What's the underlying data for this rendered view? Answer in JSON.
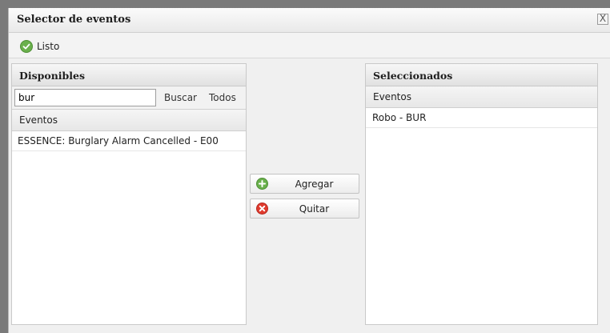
{
  "dialog": {
    "title": "Selector de eventos",
    "close_label": "X"
  },
  "toolbar": {
    "done_label": "Listo"
  },
  "available": {
    "title": "Disponibles",
    "search_value": "bur",
    "search_button": "Buscar",
    "all_button": "Todos",
    "column_header": "Eventos",
    "rows": [
      "ESSENCE: Burglary Alarm Cancelled - E00"
    ]
  },
  "actions": {
    "add_label": "Agregar",
    "remove_label": "Quitar"
  },
  "selected": {
    "title": "Seleccionados",
    "column_header": "Eventos",
    "rows": [
      "Robo - BUR"
    ]
  },
  "colors": {
    "accent_green": "#6ab04c",
    "remove_red": "#e03b2e"
  },
  "icons": {
    "done": "check-circle-icon",
    "add": "plus-circle-icon",
    "remove": "x-circle-icon"
  }
}
